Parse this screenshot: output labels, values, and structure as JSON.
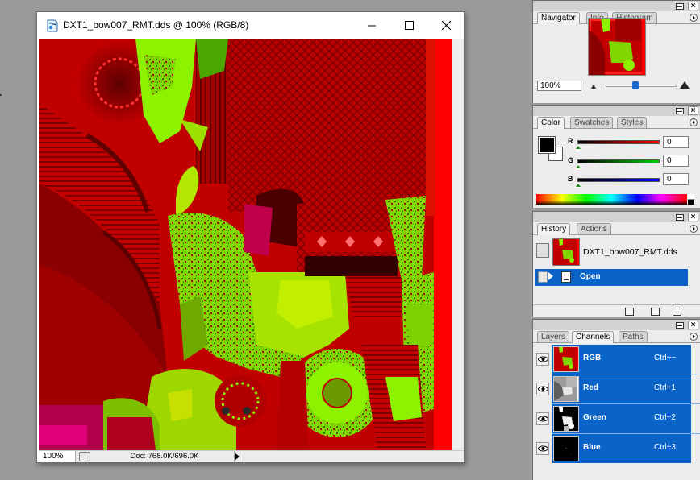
{
  "document_window": {
    "title": "DXT1_bow007_RMT.dds @ 100% (RGB/8)",
    "status_zoom": "100%",
    "status_doc": "Doc: 768.0K/696.0K"
  },
  "navigator": {
    "tabs": [
      "Navigator",
      "Info",
      "Histogram"
    ],
    "zoom_value": "100%"
  },
  "color": {
    "tabs": [
      "Color",
      "Swatches",
      "Styles"
    ],
    "channels": [
      {
        "letter": "R",
        "value": "0",
        "color": "#d00000"
      },
      {
        "letter": "G",
        "value": "0",
        "color": "#00b000"
      },
      {
        "letter": "B",
        "value": "0",
        "color": "#0000d0"
      }
    ]
  },
  "history": {
    "tabs": [
      "History",
      "Actions"
    ],
    "snapshot_label": "DXT1_bow007_RMT.dds",
    "open_label": "Open"
  },
  "channels": {
    "tabs": [
      "Layers",
      "Channels",
      "Paths"
    ],
    "rows": [
      {
        "name": "RGB",
        "shortcut": "Ctrl+~"
      },
      {
        "name": "Red",
        "shortcut": "Ctrl+1"
      },
      {
        "name": "Green",
        "shortcut": "Ctrl+2"
      },
      {
        "name": "Blue",
        "shortcut": "Ctrl+3"
      }
    ]
  },
  "colors": {
    "selection": "#0a64c8",
    "texture_red": "#c10000",
    "texture_green": "#8cf200"
  }
}
